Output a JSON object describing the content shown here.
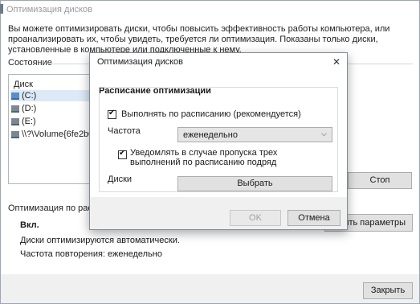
{
  "main": {
    "title": "Оптимизация дисков",
    "intro": "Вы можете оптимизировать диски, чтобы повысить эффективность работы  компьютера, или проанализировать их, чтобы увидеть, требуется ли оптимизация. Показаны только диски, установленные в компьютере или подключенные к нему.",
    "state_label": "Состояние",
    "drives_header": "Диск",
    "drives": [
      "(C:)",
      "(D:)",
      "(E:)",
      "\\\\?\\Volume{6fe2b0..."
    ],
    "stop_button": "Стоп",
    "schedule_label": "Оптимизация по расписа",
    "schedule_status": "Вкл.",
    "auto_text": "Диски оптимизируются автоматически.",
    "frequency_info": "Частота повторения: еженедельно",
    "change_button": "нить параметры",
    "close_button": "Закрыть"
  },
  "dialog": {
    "title": "Оптимизация дисков",
    "close_icon": "close-icon",
    "heading": "Расписание оптимизации",
    "schedule_checkbox": "Выполнять по расписанию (рекомендуется)",
    "frequency_label": "Частота",
    "frequency_value": "еженедельно",
    "notify_checkbox": "Уведомлять в случае пропуска трех выполнений по расписанию подряд",
    "disks_label": "Диски",
    "choose_button": "Выбрать",
    "ok_button": "OK",
    "cancel_button": "Отмена"
  }
}
